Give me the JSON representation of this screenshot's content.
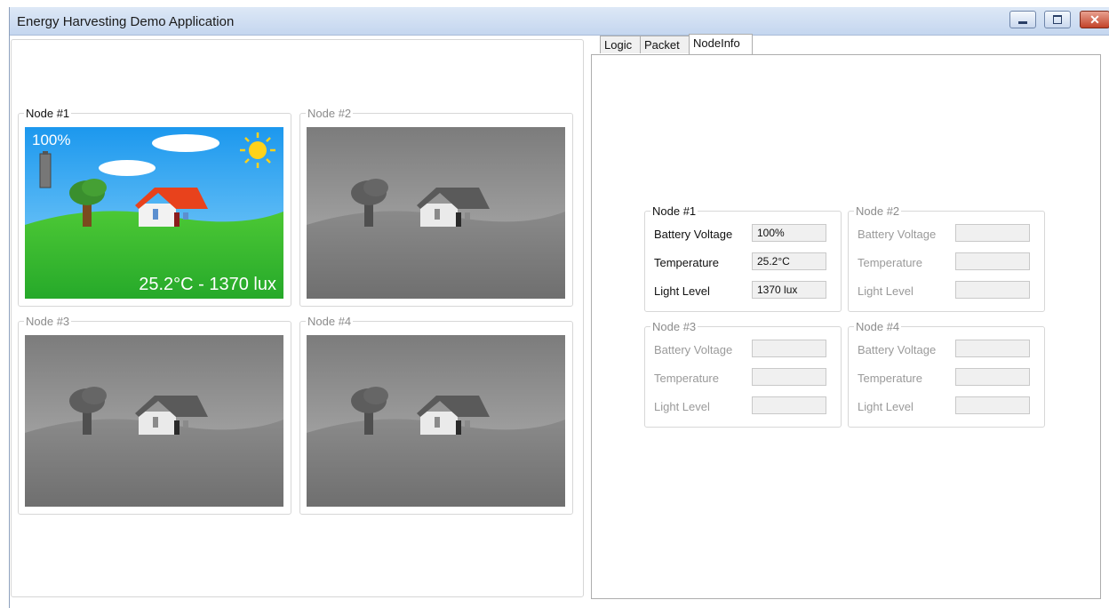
{
  "window": {
    "title": "Energy Harvesting Demo Application",
    "controls": [
      "minimize",
      "maximize",
      "close"
    ]
  },
  "nodes": [
    {
      "label": "Node #1",
      "active": true,
      "battery": "100%",
      "reading": "25.2°C - 1370 lux"
    },
    {
      "label": "Node #2",
      "active": false
    },
    {
      "label": "Node #3",
      "active": false
    },
    {
      "label": "Node #4",
      "active": false
    }
  ],
  "tabs": [
    {
      "label": "Logic",
      "selected": false
    },
    {
      "label": "Packet",
      "selected": false
    },
    {
      "label": "NodeInfo",
      "selected": true
    }
  ],
  "nodeinfo": {
    "field_labels": [
      "Battery Voltage",
      "Temperature",
      "Light Level"
    ],
    "nodes": [
      {
        "label": "Node #1",
        "active": true,
        "values": [
          "100%",
          "25.2°C",
          "1370 lux"
        ]
      },
      {
        "label": "Node #2",
        "active": false,
        "values": [
          "",
          "",
          ""
        ]
      },
      {
        "label": "Node #3",
        "active": false,
        "values": [
          "",
          "",
          ""
        ]
      },
      {
        "label": "Node #4",
        "active": false,
        "values": [
          "",
          "",
          ""
        ]
      }
    ]
  },
  "colors": {
    "titlebar": "#c4d6ef",
    "sky": "#1fa3f0",
    "grass": "#2fb52c",
    "roof": "#e8421c",
    "grey_scene": "#8c8c8c"
  }
}
